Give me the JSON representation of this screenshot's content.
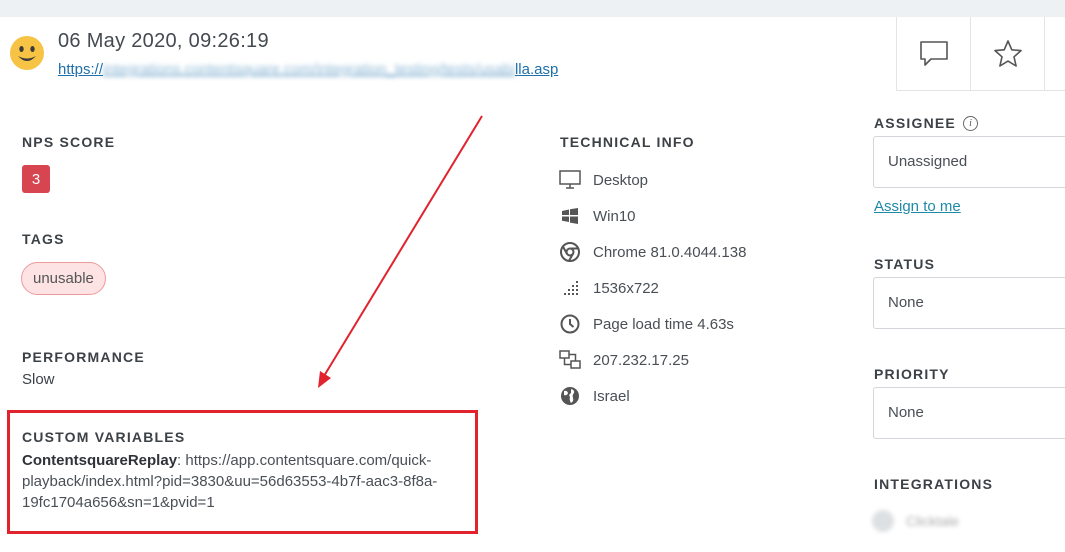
{
  "header": {
    "datetime": "06 May 2020, 09:26:19",
    "url_prefix": "https://",
    "url_blurred": "integrations.contentsquare.com/integration_testing/tests/usabi",
    "url_suffix": "lla.asp"
  },
  "actions": {
    "comment_icon": "comment-icon",
    "star_icon": "star-icon"
  },
  "nps": {
    "title": "NPS SCORE",
    "score": "3"
  },
  "tags": {
    "title": "TAGS",
    "items": [
      "unusable"
    ]
  },
  "performance": {
    "title": "PERFORMANCE",
    "value": "Slow"
  },
  "custom_variables": {
    "title": "CUSTOM VARIABLES",
    "name": "ContentsquareReplay",
    "value": ": https://app.contentsquare.com/quick-playback/index.html?pid=3830&uu=56d63553-4b7f-aac3-8f8a-19fc1704a656&sn=1&pvid=1"
  },
  "technical": {
    "title": "TECHNICAL INFO",
    "items": [
      {
        "icon": "desktop-icon",
        "label": "Desktop"
      },
      {
        "icon": "windows-icon",
        "label": "Win10"
      },
      {
        "icon": "chrome-icon",
        "label": "Chrome 81.0.4044.138"
      },
      {
        "icon": "resolution-icon",
        "label": "1536x722"
      },
      {
        "icon": "clock-icon",
        "label": "Page load time 4.63s"
      },
      {
        "icon": "network-icon",
        "label": "207.232.17.25"
      },
      {
        "icon": "globe-icon",
        "label": "Israel"
      }
    ]
  },
  "assignee": {
    "title": "ASSIGNEE",
    "value": "Unassigned",
    "assign_link": "Assign to me"
  },
  "status": {
    "title": "STATUS",
    "value": "None"
  },
  "priority": {
    "title": "PRIORITY",
    "value": "None"
  },
  "integrations": {
    "title": "INTEGRATIONS",
    "item": "Clicktale"
  },
  "colors": {
    "highlight": "#e0232d",
    "nps_badge": "#d64550",
    "link": "#1f8aa8"
  }
}
